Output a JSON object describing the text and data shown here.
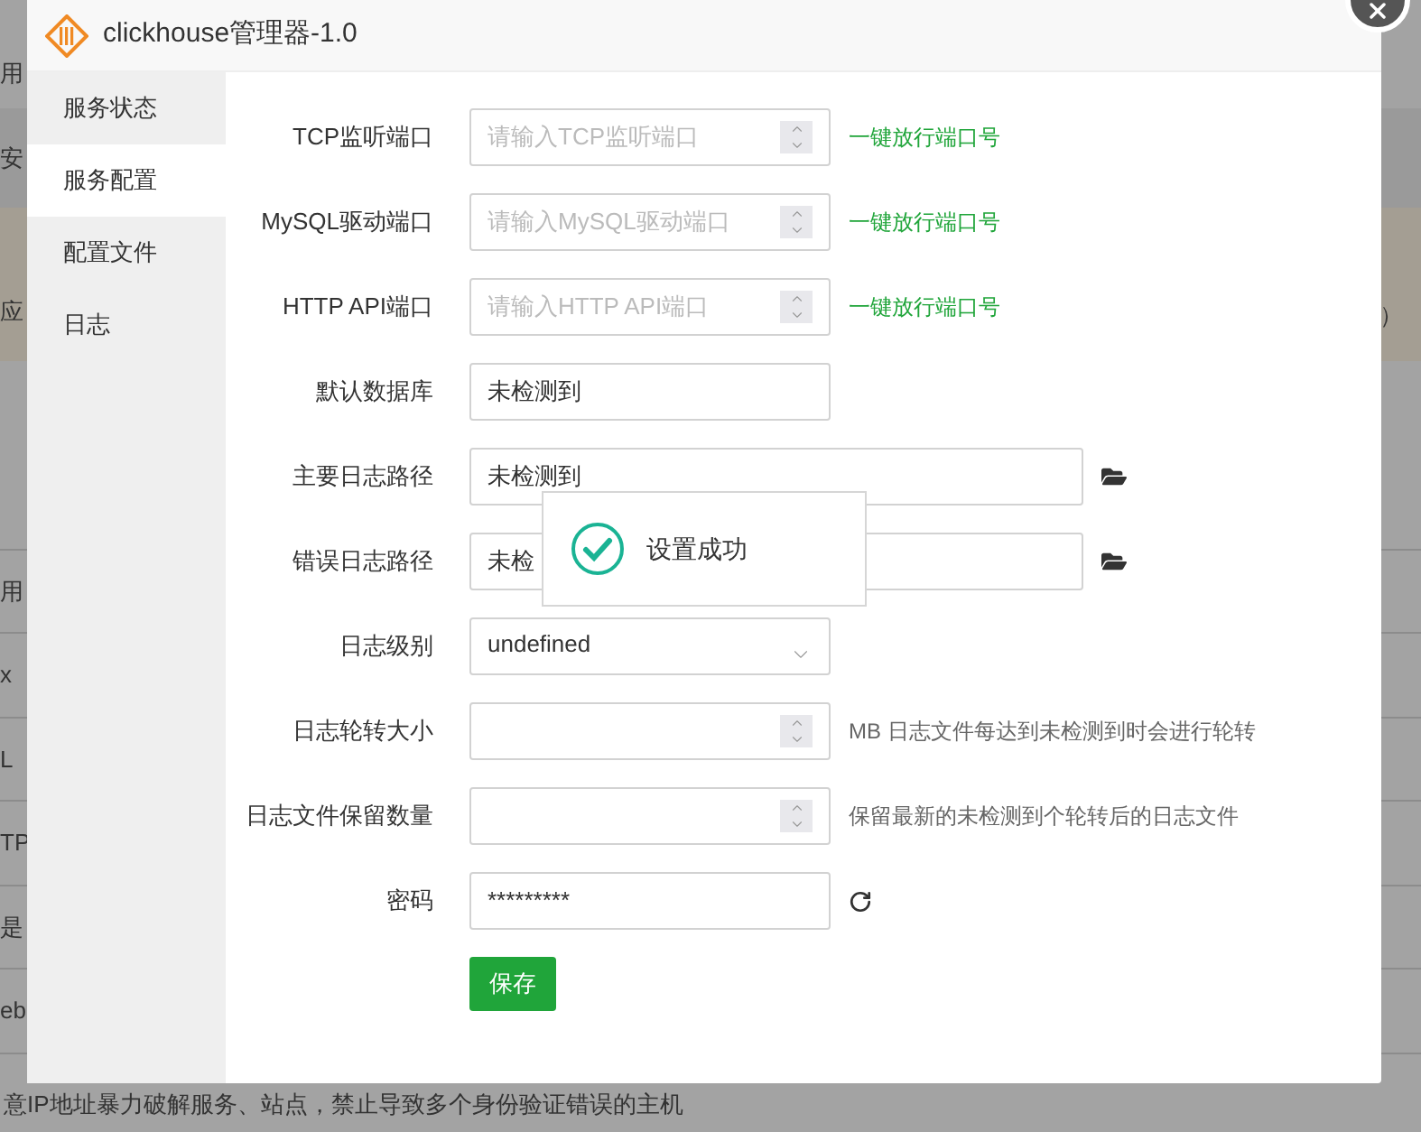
{
  "background": {
    "rows": [
      {
        "kind": "plain",
        "left": "用"
      },
      {
        "kind": "dark",
        "left": "安"
      },
      {
        "kind": "notice",
        "left2": "应",
        "right": "）"
      },
      {
        "kind": "plain"
      },
      {
        "kind": "line"
      },
      {
        "kind": "line",
        "left": "用"
      },
      {
        "kind": "line",
        "left": "x"
      },
      {
        "kind": "line",
        "left": "L"
      },
      {
        "kind": "line",
        "left": "TP"
      },
      {
        "kind": "line",
        "left": "是"
      },
      {
        "kind": "line",
        "left": "eb"
      }
    ],
    "footer_text": "意IP地址暴力破解服务、站点，禁止导致多个身份验证错误的主机"
  },
  "dialog": {
    "title": "clickhouse管理器-1.0"
  },
  "sidebar": {
    "items": [
      {
        "label": "服务状态",
        "selected": false
      },
      {
        "label": "服务配置",
        "selected": true
      },
      {
        "label": "配置文件",
        "selected": false
      },
      {
        "label": "日志",
        "selected": false
      }
    ]
  },
  "form": {
    "fields": [
      {
        "kind": "number",
        "label": "TCP监听端口",
        "placeholder": "请输入TCP监听端口",
        "action": "一键放行端口号"
      },
      {
        "kind": "number",
        "label": "MySQL驱动端口",
        "placeholder": "请输入MySQL驱动端口",
        "action": "一键放行端口号"
      },
      {
        "kind": "number",
        "label": "HTTP API端口",
        "placeholder": "请输入HTTP API端口",
        "action": "一键放行端口号"
      },
      {
        "kind": "text",
        "label": "默认数据库",
        "value": "未检测到"
      },
      {
        "kind": "path",
        "label": "主要日志路径",
        "value": "未检测到"
      },
      {
        "kind": "path",
        "label": "错误日志路径",
        "value": "未检"
      },
      {
        "kind": "select",
        "label": "日志级别",
        "value": "undefined"
      },
      {
        "kind": "number",
        "label": "日志轮转大小",
        "hint": "MB 日志文件每达到未检测到时会进行轮转"
      },
      {
        "kind": "number",
        "label": "日志文件保留数量",
        "hint": "保留最新的未检测到个轮转后的日志文件"
      },
      {
        "kind": "password",
        "label": "密码",
        "value": "*********"
      }
    ],
    "save_button": "保存"
  },
  "toast": {
    "message": "设置成功"
  }
}
